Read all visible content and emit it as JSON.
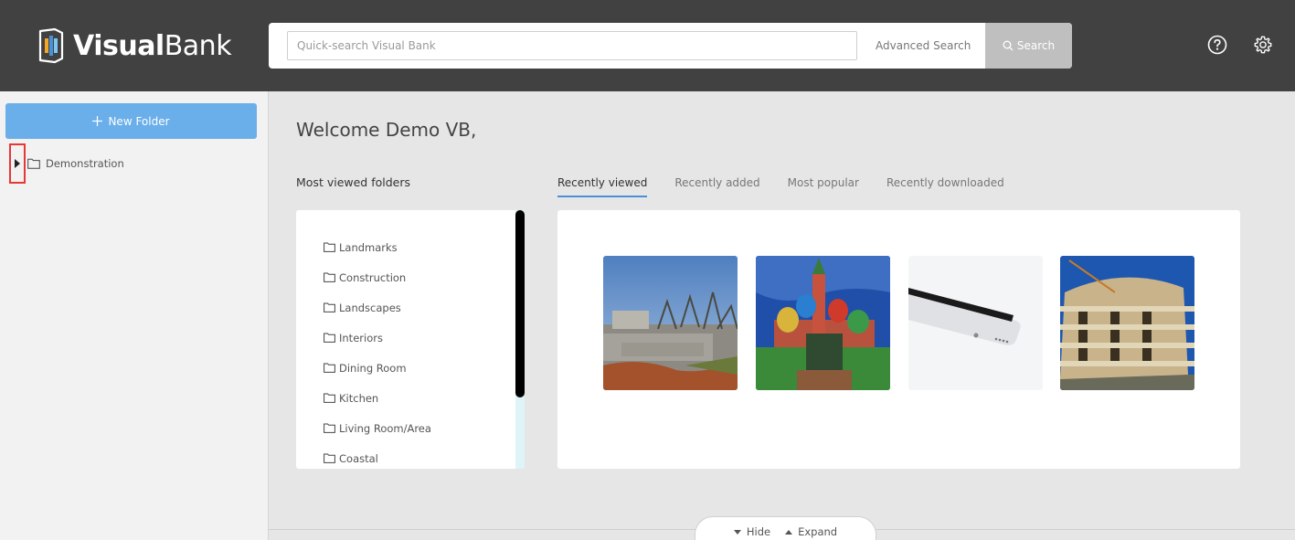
{
  "header": {
    "logo_bold": "Visual",
    "logo_light": "Bank",
    "search_placeholder": "Quick-search Visual Bank",
    "advanced_search": "Advanced Search",
    "search_button": "Search"
  },
  "sidebar": {
    "new_folder": "New Folder",
    "tree": [
      {
        "label": "Demonstration"
      }
    ]
  },
  "main": {
    "welcome": "Welcome Demo VB,",
    "most_viewed_title": "Most viewed folders",
    "folders": [
      "Landmarks",
      "Construction",
      "Landscapes",
      "Interiors",
      "Dining Room",
      "Kitchen",
      "Living Room/Area",
      "Coastal"
    ],
    "tabs": [
      {
        "label": "Recently viewed",
        "active": true
      },
      {
        "label": "Recently added",
        "active": false
      },
      {
        "label": "Most popular",
        "active": false
      },
      {
        "label": "Recently downloaded",
        "active": false
      }
    ],
    "images": [
      "construction-site-image",
      "st-basils-cathedral-image",
      "smartphone-image",
      "building-under-construction-image"
    ]
  },
  "footer": {
    "hide": "Hide",
    "expand": "Expand"
  },
  "colors": {
    "header_bg": "#414141",
    "accent": "#6aaeea",
    "tab_underline": "#4a90d9"
  }
}
